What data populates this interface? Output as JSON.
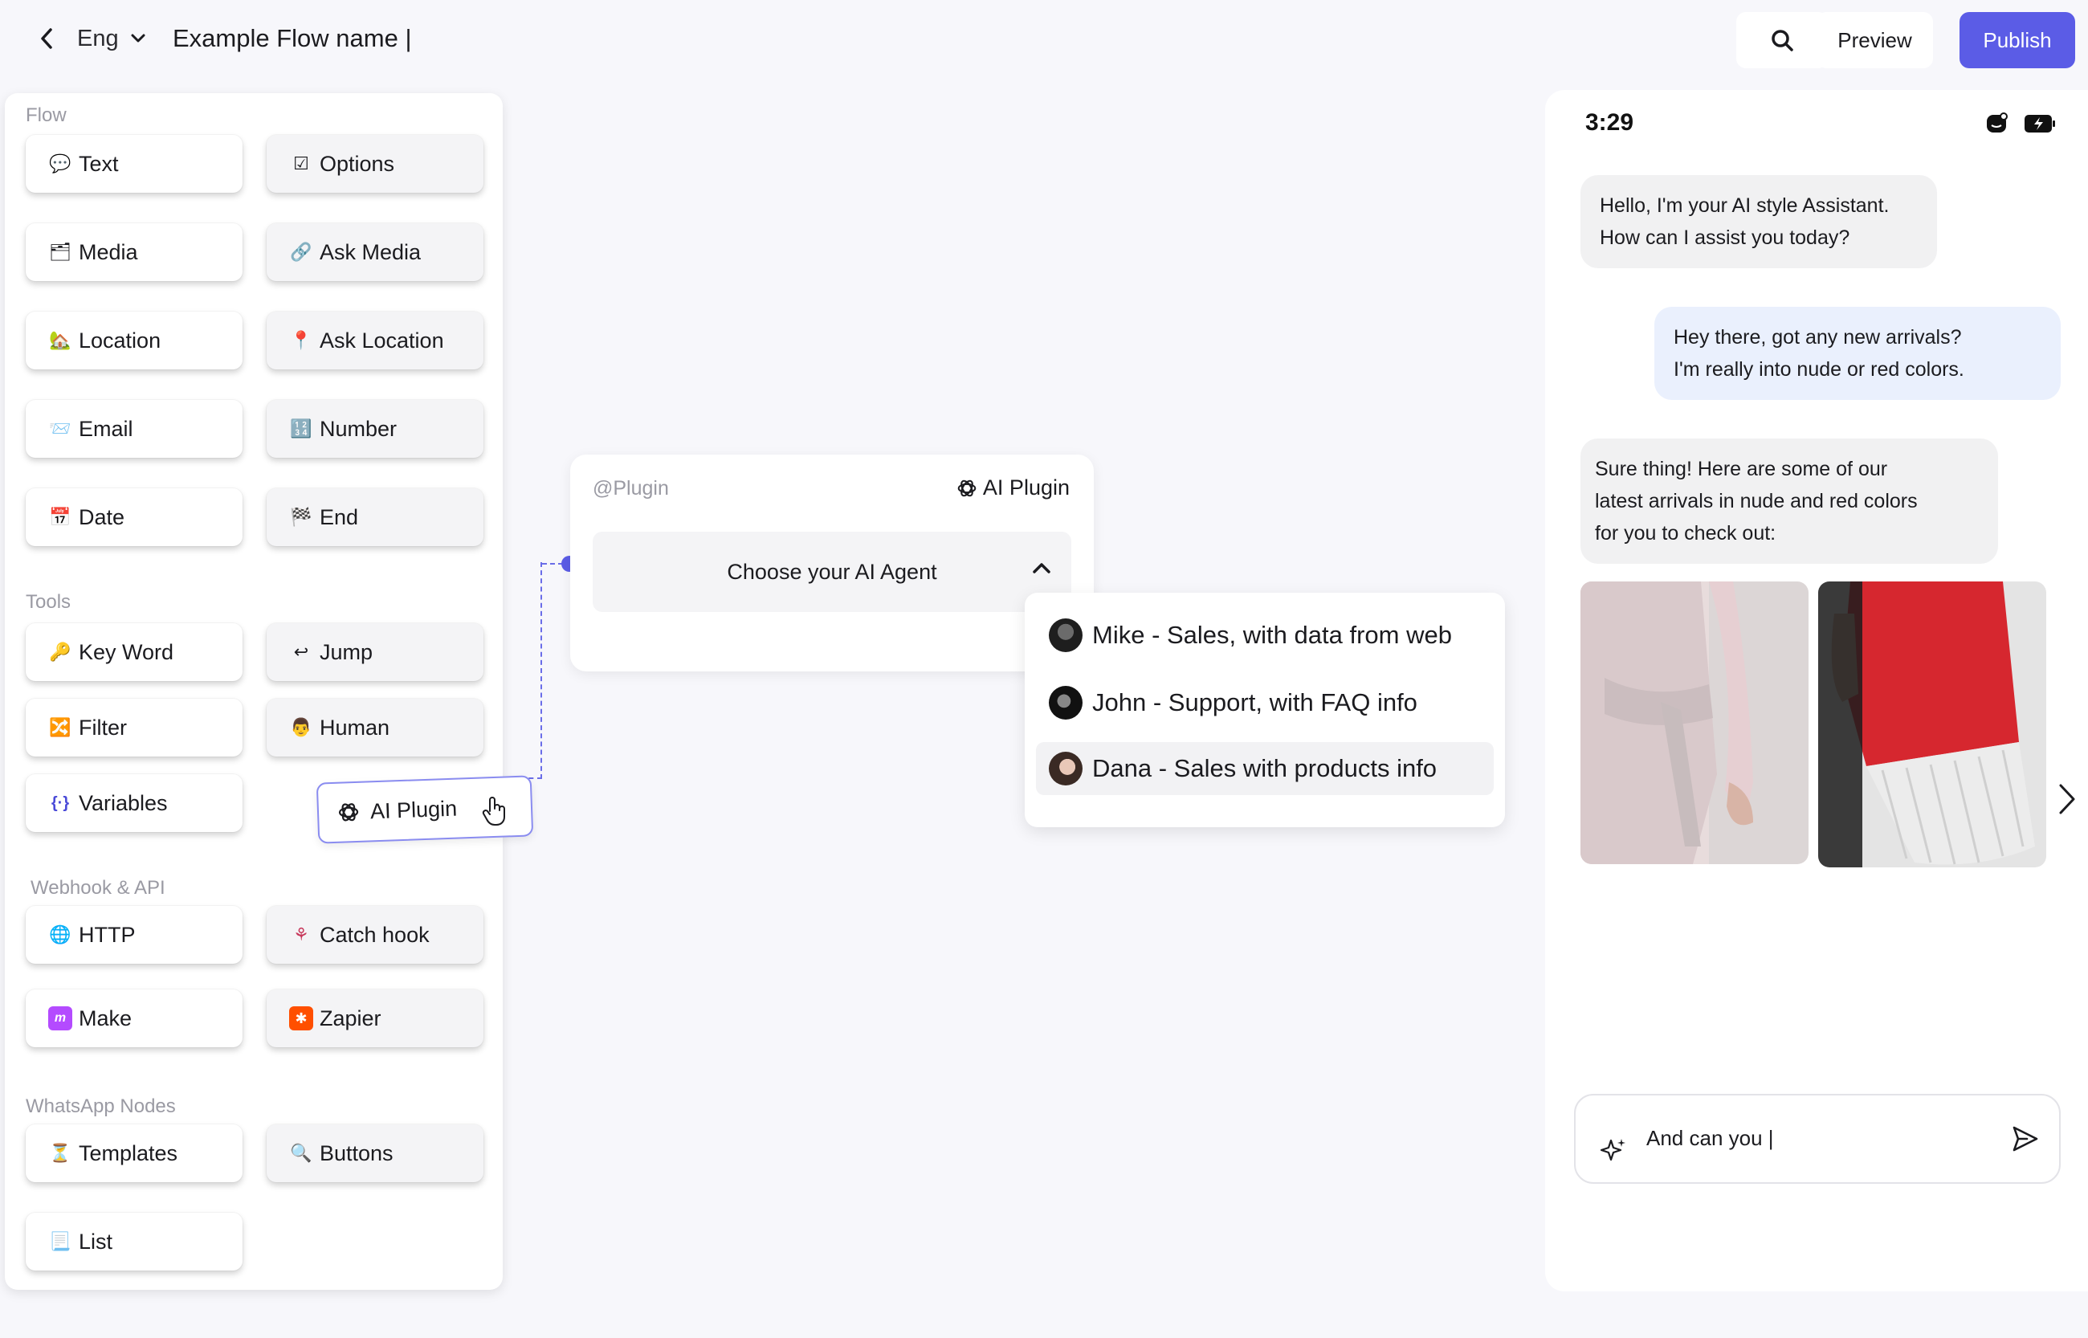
{
  "header": {
    "language": "Eng",
    "flow_name": "Example Flow name |",
    "preview_label": "Preview",
    "publish_label": "Publish"
  },
  "panel": {
    "sections": {
      "flow": "Flow",
      "tools": "Tools",
      "webhook": "Webhook & API",
      "whatsapp": "WhatsApp Nodes"
    },
    "nodes": {
      "text": "Text",
      "options": "Options",
      "media": "Media",
      "ask_media": "Ask Media",
      "location": "Location",
      "ask_location": "Ask Location",
      "email": "Email",
      "number": "Number",
      "date": "Date",
      "end": "End",
      "key_word": "Key Word",
      "jump": "Jump",
      "filter": "Filter",
      "human": "Human",
      "variables": "Variables",
      "http": "HTTP",
      "catch_hook": "Catch hook",
      "make": "Make",
      "zapier": "Zapier",
      "templates": "Templates",
      "buttons": "Buttons",
      "list": "List"
    },
    "drag_ghost": "AI Plugin"
  },
  "plugin": {
    "tag": "@Plugin",
    "name": "AI Plugin",
    "select_placeholder": "Choose your AI Agent",
    "options": [
      "Mike - Sales, with data from web",
      "John - Support, with FAQ info",
      "Dana - Sales with products info"
    ]
  },
  "phone": {
    "time": "3:29",
    "messages": {
      "bot1": [
        "Hello, I'm your AI style Assistant.",
        "How can I assist you today?"
      ],
      "user1": [
        "Hey there, got any new arrivals?",
        "I'm really into nude or red colors."
      ],
      "bot2": [
        "Sure thing! Here are some of our",
        "latest arrivals in nude and red colors",
        "for you to check out:"
      ]
    },
    "composer_text": "And can you |"
  },
  "colors": {
    "accent": "#5b5ce6",
    "user_bubble": "#eaf0fd",
    "bot_bubble": "#f1f1f2"
  },
  "icons": [
    "back-chevron-icon",
    "chevron-down-icon",
    "search-icon",
    "openai-icon",
    "chevron-up-icon",
    "chevron-right-icon",
    "sparkle-icon",
    "send-icon",
    "hand-cursor-icon"
  ]
}
